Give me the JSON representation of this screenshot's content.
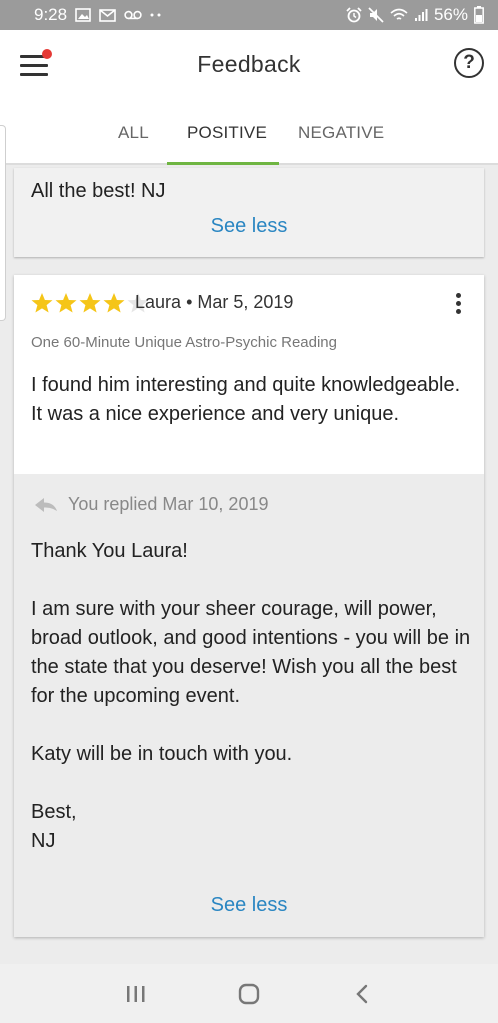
{
  "status_bar": {
    "time": "9:28",
    "battery": "56%"
  },
  "header": {
    "title": "Feedback",
    "help_symbol": "?"
  },
  "tabs": [
    {
      "label": "ALL",
      "active": false
    },
    {
      "label": "POSITIVE",
      "active": true
    },
    {
      "label": "NEGATIVE",
      "active": false
    }
  ],
  "previous_card": {
    "signoff": "All the best! NJ",
    "see_less": "See less"
  },
  "review": {
    "rating": 4,
    "max_rating": 5,
    "author": "Laura",
    "date": "Mar 5, 2019",
    "product": "One 60-Minute Unique Astro-Psychic Reading",
    "text": "I found him interesting and quite knowledgeable. It was a nice experience and very unique.",
    "reply": {
      "header": "You replied Mar 10, 2019",
      "text": "Thank You Laura!\n\nI am sure with your sheer courage, will power, broad outlook, and good intentions - you will be in the state that you deserve! Wish you all the best for the upcoming event.\n\nKaty will be in touch with you.\n\nBest,\nNJ",
      "see_less": "See less"
    }
  },
  "colors": {
    "accent": "#6fb542",
    "link": "#2a86c2",
    "star": "#f5c518",
    "notification": "#e53935"
  },
  "icons": [
    "menu-icon",
    "help-icon",
    "more-vertical-icon",
    "reply-arrow-icon",
    "recents-icon",
    "home-icon",
    "back-icon"
  ]
}
